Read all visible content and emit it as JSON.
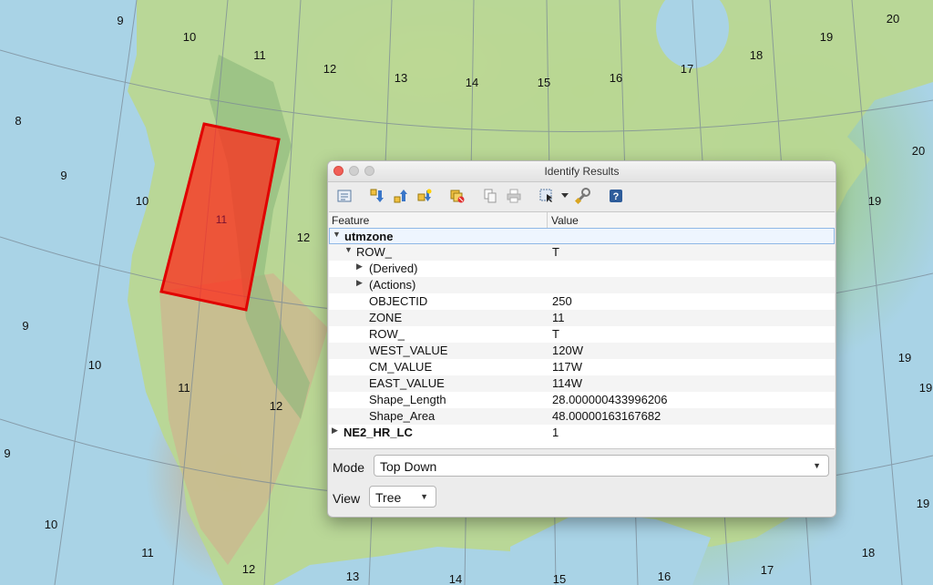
{
  "map": {
    "zone_labels": [
      "9",
      "10",
      "11",
      "12",
      "13",
      "14",
      "15",
      "16",
      "17",
      "18",
      "19",
      "20",
      "8",
      "9",
      "10",
      "12",
      "19",
      "20",
      "9",
      "10",
      "11",
      "12",
      "19",
      "9",
      "10",
      "11",
      "12",
      "13",
      "14",
      "15",
      "16",
      "17",
      "18",
      "19",
      "19"
    ],
    "selected_zone_label": "11",
    "colors": {
      "selection_fill": "#ff2a1a",
      "selection_stroke": "#e00000",
      "ocean": "#a9d3e6"
    }
  },
  "dialog": {
    "title": "Identify Results",
    "toolbar_icons": [
      "expand-tree-icon",
      "expand-all-icon",
      "collapse-all-icon",
      "expand-new-icon",
      "clear-results-icon",
      "copy-feature-icon",
      "print-icon",
      "select-features-icon",
      "dropdown-arrow-icon",
      "settings-wrench-icon",
      "help-icon"
    ],
    "columns": {
      "feature": "Feature",
      "value": "Value"
    },
    "rows": [
      {
        "label": "utmzone",
        "value": ""
      },
      {
        "label": "ROW_",
        "value": "T"
      },
      {
        "label": "(Derived)",
        "value": ""
      },
      {
        "label": "(Actions)",
        "value": ""
      },
      {
        "label": "OBJECTID",
        "value": "250"
      },
      {
        "label": "ZONE",
        "value": "11"
      },
      {
        "label": "ROW_",
        "value": "T"
      },
      {
        "label": "WEST_VALUE",
        "value": "120W"
      },
      {
        "label": "CM_VALUE",
        "value": "117W"
      },
      {
        "label": "EAST_VALUE",
        "value": "114W"
      },
      {
        "label": "Shape_Length",
        "value": "28.000000433996206"
      },
      {
        "label": "Shape_Area",
        "value": "48.00000163167682"
      },
      {
        "label": "NE2_HR_LC",
        "value": "1"
      }
    ],
    "mode_label": "Mode",
    "mode_value": "Top Down",
    "view_label": "View",
    "view_value": "Tree"
  }
}
